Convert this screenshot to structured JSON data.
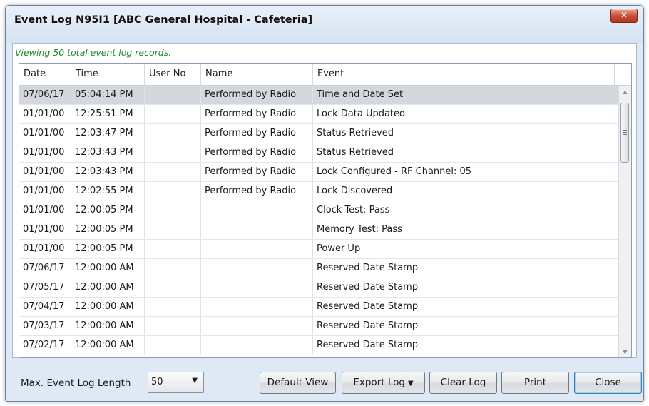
{
  "window": {
    "title": "Event Log N95I1 [ABC General Hospital - Cafeteria]",
    "close_glyph": "✕"
  },
  "summary": "Viewing 50 total event log records.",
  "table": {
    "columns": [
      "Date",
      "Time",
      "User No",
      "Name",
      "Event"
    ],
    "selected_row": 0,
    "rows": [
      [
        "07/06/17",
        "05:04:14 PM",
        "",
        "Performed by Radio",
        "Time and Date Set"
      ],
      [
        "01/01/00",
        "12:25:51 PM",
        "",
        "Performed by Radio",
        "Lock Data Updated"
      ],
      [
        "01/01/00",
        "12:03:47 PM",
        "",
        "Performed by Radio",
        "Status Retrieved"
      ],
      [
        "01/01/00",
        "12:03:43 PM",
        "",
        "Performed by Radio",
        "Status Retrieved"
      ],
      [
        "01/01/00",
        "12:03:43 PM",
        "",
        "Performed by Radio",
        "Lock Configured - RF Channel: 05"
      ],
      [
        "01/01/00",
        "12:02:55 PM",
        "",
        "Performed by Radio",
        "Lock Discovered"
      ],
      [
        "01/01/00",
        "12:00:05 PM",
        "",
        "",
        "Clock Test: Pass"
      ],
      [
        "01/01/00",
        "12:00:05 PM",
        "",
        "",
        "Memory Test: Pass"
      ],
      [
        "01/01/00",
        "12:00:05 PM",
        "",
        "",
        "Power Up"
      ],
      [
        "07/06/17",
        "12:00:00 AM",
        "",
        "",
        "Reserved Date Stamp"
      ],
      [
        "07/05/17",
        "12:00:00 AM",
        "",
        "",
        "Reserved Date Stamp"
      ],
      [
        "07/04/17",
        "12:00:00 AM",
        "",
        "",
        "Reserved Date Stamp"
      ],
      [
        "07/03/17",
        "12:00:00 AM",
        "",
        "",
        "Reserved Date Stamp"
      ],
      [
        "07/02/17",
        "12:00:00 AM",
        "",
        "",
        "Reserved Date Stamp"
      ]
    ]
  },
  "scrollbar": {
    "up_glyph": "▲",
    "down_glyph": "▼"
  },
  "footer": {
    "max_length_label": "Max. Event Log Length",
    "max_length_value": "50",
    "dropdown_glyph": "▼",
    "buttons": {
      "default_view": "Default View",
      "export_log": "Export Log",
      "clear_log": "Clear Log",
      "print": "Print",
      "close": "Close"
    }
  },
  "colors": {
    "summary_text": "#1f8a28",
    "selected_row": "#d4d7db",
    "close_x": "#c9503a"
  }
}
